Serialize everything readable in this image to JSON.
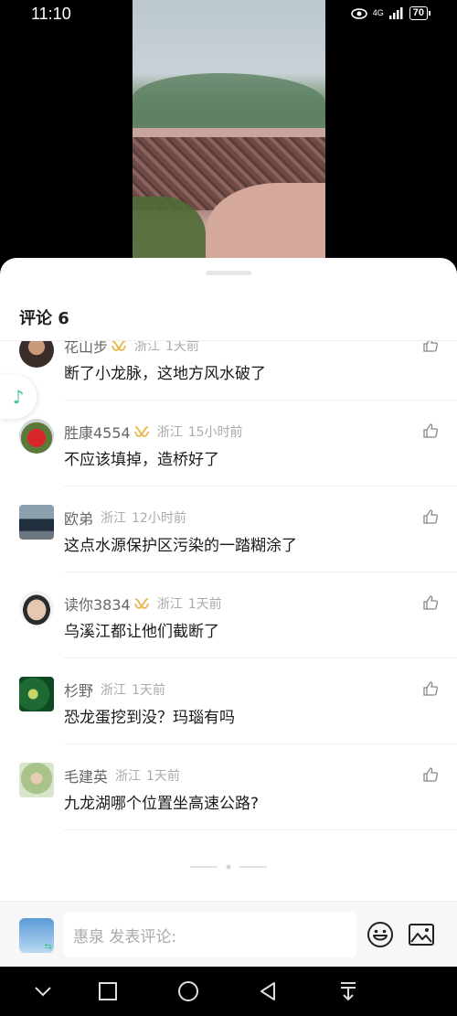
{
  "status_bar": {
    "time": "11:10",
    "network": "4G",
    "battery": "70"
  },
  "sheet": {
    "title": "评论 6",
    "input_placeholder": "惠泉 发表评论:"
  },
  "comments": [
    {
      "username": "花山步",
      "location": "浙江",
      "time": "1天前",
      "text": "断了小龙脉，这地方风水破了",
      "vip": true
    },
    {
      "username": "胜康4554",
      "location": "浙江",
      "time": "15小时前",
      "text": "不应该填掉，造桥好了",
      "vip": true
    },
    {
      "username": "欧弟",
      "location": "浙江",
      "time": "12小时前",
      "text": "这点水源保护区污染的一踏糊涂了",
      "vip": false
    },
    {
      "username": "读你3834",
      "location": "浙江",
      "time": "1天前",
      "text": "乌溪江都让他们截断了",
      "vip": true
    },
    {
      "username": "杉野",
      "location": "浙江",
      "time": "1天前",
      "text": "恐龙蛋挖到没？玛瑙有吗",
      "vip": false
    },
    {
      "username": "毛建英",
      "location": "浙江",
      "time": "1天前",
      "text": "九龙湖哪个位置坐高速公路?",
      "vip": false
    }
  ],
  "colors": {
    "vip_gold": "#e8b64c",
    "accent_green": "#3cc48c",
    "muted_text": "#aaaaaa"
  },
  "icons": [
    "eye-icon",
    "signal-icon",
    "battery-icon",
    "music-note-icon",
    "thumbs-up-icon",
    "emoji-icon",
    "image-icon",
    "chevron-down-icon",
    "square-icon",
    "circle-icon",
    "back-triangle-icon",
    "download-icon"
  ]
}
